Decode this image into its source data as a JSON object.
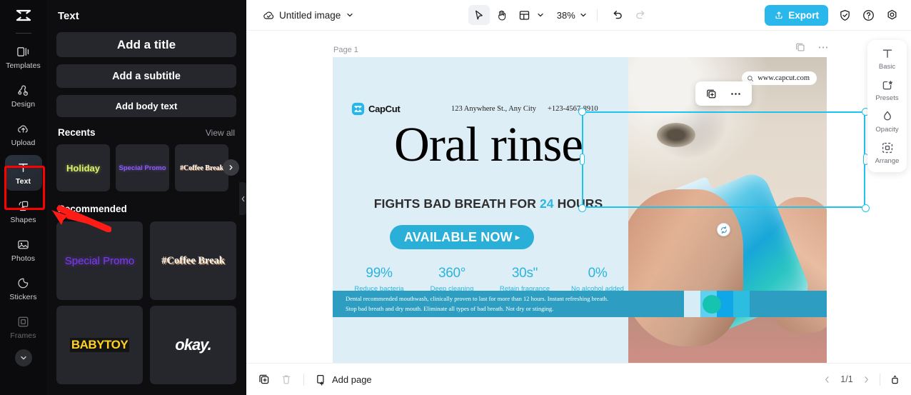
{
  "rail": {
    "logo_icon": "capcut-logo",
    "items": [
      {
        "label": "Templates",
        "icon": "templates-icon",
        "active": false
      },
      {
        "label": "Design",
        "icon": "design-icon",
        "active": false
      },
      {
        "label": "Upload",
        "icon": "upload-cloud-icon",
        "active": false
      },
      {
        "label": "Text",
        "icon": "text-t-icon",
        "active": true
      },
      {
        "label": "Shapes",
        "icon": "shapes-icon",
        "active": false
      },
      {
        "label": "Photos",
        "icon": "photos-icon",
        "active": false
      },
      {
        "label": "Stickers",
        "icon": "stickers-icon",
        "active": false
      },
      {
        "label": "Frames",
        "icon": "frames-icon",
        "active": false
      }
    ],
    "expand_icon": "chevron-down-icon"
  },
  "panel": {
    "title": "Text",
    "add_title": "Add a title",
    "add_subtitle": "Add a subtitle",
    "add_body": "Add body text",
    "recents_label": "Recents",
    "view_all": "View all",
    "recents": [
      {
        "label": "Holiday"
      },
      {
        "label": "Special Promo"
      },
      {
        "label": "#Coffee Break"
      }
    ],
    "recommended_label": "Recommended",
    "recommended": [
      {
        "label": "Special Promo"
      },
      {
        "label": "#Coffee Break"
      },
      {
        "label": "BABYTOY"
      },
      {
        "label": "okay."
      }
    ],
    "next_icon": "chevron-right-icon",
    "collapse_icon": "chevron-left-icon"
  },
  "topbar": {
    "cloud_icon": "cloud-saved-icon",
    "doc_name": "Untitled image",
    "doc_chevron": "chevron-down-icon",
    "tools": [
      {
        "name": "select-tool",
        "icon": "cursor-arrow-icon",
        "selected": true
      },
      {
        "name": "hand-tool",
        "icon": "hand-icon",
        "selected": false
      },
      {
        "name": "layout-tool",
        "icon": "layout-grid-icon",
        "selected": false
      }
    ],
    "zoom_level": "38%",
    "zoom_chevron": "chevron-down-icon",
    "undo_icon": "undo-icon",
    "redo_icon": "redo-icon",
    "export_label": "Export",
    "export_icon": "export-upload-icon",
    "export_color": "#2ab7ec",
    "shield_icon": "shield-check-icon",
    "help_icon": "question-circle-icon",
    "settings_icon": "gear-icon"
  },
  "canvas": {
    "page_label": "Page 1",
    "page_duplicate_icon": "duplicate-page-icon",
    "page_more_icon": "more-options-icon",
    "float_duplicate_icon": "duplicate-icon",
    "float_more_icon": "more-options-icon",
    "rotate_icon": "rotate-handle-icon",
    "selection_color": "#20c3ee"
  },
  "design": {
    "brand": "CapCut",
    "brand_logo_icon": "capcut-badge-icon",
    "address": "123 Anywhere St., Any City",
    "phone": "+123-4567-8910",
    "headline": "Oral rinse",
    "subhead_before": "FIGHTS BAD BREATH FOR ",
    "subhead_highlight": "24",
    "subhead_after": " HOURS",
    "cta": "AVAILABLE NOW",
    "cta_arrow": "▸",
    "stats": [
      {
        "value": "99%",
        "label": "Reduce bacteria"
      },
      {
        "value": "360°",
        "label": "Deep cleaning"
      },
      {
        "value": "30s\"",
        "label": "Retain fragrance"
      },
      {
        "value": "0%",
        "label": "No alcohol added"
      }
    ],
    "url_text": "www.capcut.com",
    "url_icon": "search-icon",
    "banner_line1": "Dental recommended mouthwash, clinically proven to last for more than 12 hours. Instant refreshing breath.",
    "banner_line2": "Stop bad breath and dry mouth. Eliminate all types of bad breath. Not dry or stinging.",
    "banner_color": "#2d9ec2",
    "swatch_colors": [
      "#d6ecf7",
      "#5fd0f2",
      "#0fa7e8",
      "#2cbde0"
    ],
    "accent_color": "#2ab0d8"
  },
  "right_panel": {
    "items": [
      {
        "label": "Basic",
        "icon": "text-basic-icon"
      },
      {
        "label": "Presets",
        "icon": "presets-star-icon"
      },
      {
        "label": "Opacity",
        "icon": "opacity-droplet-icon"
      },
      {
        "label": "Arrange",
        "icon": "arrange-icon"
      }
    ]
  },
  "bottombar": {
    "duplicate_icon": "duplicate-page-icon",
    "delete_icon": "trash-icon",
    "add_page": "Add page",
    "add_page_icon": "add-page-icon",
    "prev_icon": "chevron-left-icon",
    "page_indicator": "1/1",
    "next_icon": "chevron-right-icon",
    "expand_icon": "expand-panel-icon"
  },
  "annotations": {
    "highlight_color": "#ff0000",
    "arrow_target": "Text"
  }
}
